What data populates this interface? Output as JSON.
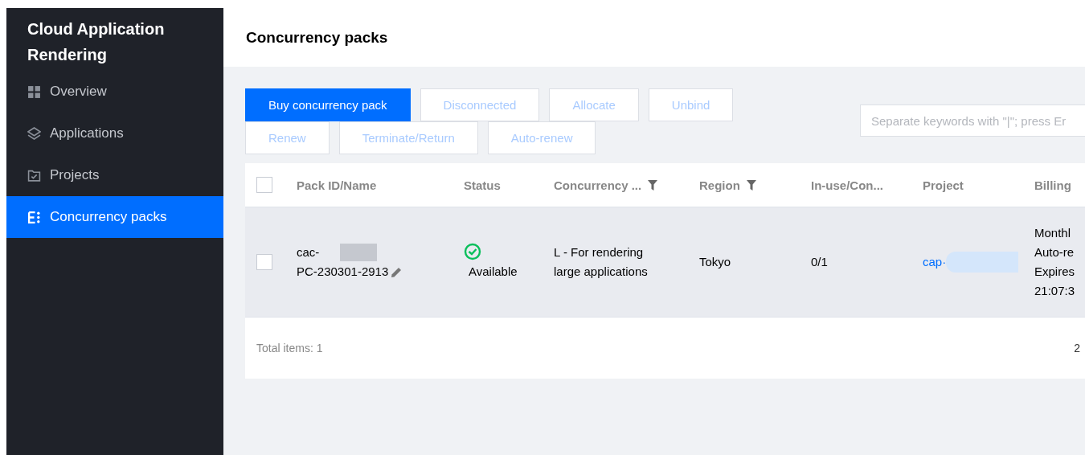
{
  "sidebar": {
    "title": "Cloud Application Rendering",
    "items": [
      {
        "label": "Overview",
        "selected": false
      },
      {
        "label": "Applications",
        "selected": false
      },
      {
        "label": "Projects",
        "selected": false
      },
      {
        "label": "Concurrency packs",
        "selected": true
      }
    ]
  },
  "page": {
    "title": "Concurrency packs"
  },
  "toolbar": {
    "buttons": [
      [
        {
          "label": "Buy concurrency pack",
          "kind": "primary",
          "disabled": false
        },
        {
          "label": "Disconnected",
          "kind": "default",
          "disabled": true
        },
        {
          "label": "Allocate",
          "kind": "default",
          "disabled": true
        },
        {
          "label": "Unbind",
          "kind": "default",
          "disabled": true
        }
      ],
      [
        {
          "label": "Renew",
          "kind": "default",
          "disabled": true
        },
        {
          "label": "Terminate/Return",
          "kind": "default",
          "disabled": true
        },
        {
          "label": "Auto-renew",
          "kind": "default",
          "disabled": true
        }
      ]
    ],
    "search": {
      "placeholder": "Separate keywords with \"|\"; press Er"
    }
  },
  "table": {
    "select_all": {
      "checked": false
    },
    "columns": [
      {
        "label": "Pack ID/Name",
        "filter": false
      },
      {
        "label": "Status",
        "filter": false
      },
      {
        "label": "Concurrency ...",
        "filter": true
      },
      {
        "label": "Region",
        "filter": true
      },
      {
        "label": "In-use/Con...",
        "filter": false
      },
      {
        "label": "Project",
        "filter": false
      },
      {
        "label": "Billing",
        "filter": false
      }
    ],
    "rows": [
      {
        "checked": false,
        "id": "cac-",
        "name": "PC-230301-2913",
        "status": "Available",
        "concurrency": [
          "L - For rendering",
          "large applications"
        ],
        "region": "Tokyo",
        "in_use": "0/1",
        "project": "cap·",
        "billing": [
          "Monthl",
          "Auto-re",
          "Expires",
          "21:07:3"
        ]
      }
    ],
    "total": "Total items:  1",
    "page_size": "2"
  }
}
